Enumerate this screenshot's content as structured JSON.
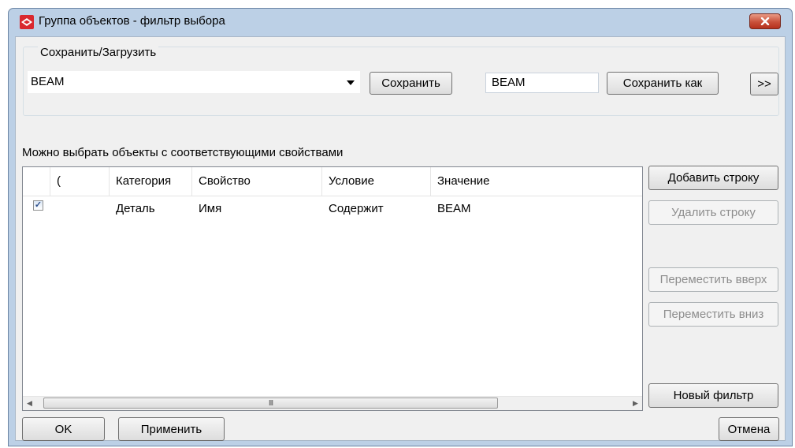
{
  "window": {
    "title": "Группа объектов - фильтр выбора",
    "close_label": "x",
    "accent": "#bcd0e6"
  },
  "save_load": {
    "label": "Сохранить/Загрузить",
    "combo_value": "BEAM",
    "save_label": "Сохранить",
    "name_value": "BEAM",
    "save_as_label": "Сохранить как",
    "more_label": ">>"
  },
  "hint": "Можно выбрать объекты с соответствующими свойствами",
  "table": {
    "columns": [
      "(",
      "Категория",
      "Свойство",
      "Условие",
      "Значение"
    ],
    "rows": [
      {
        "checked": true,
        "paren": "",
        "category": "Деталь",
        "property": "Имя",
        "condition": "Содержит",
        "value": "BEAM"
      }
    ],
    "scroll_thumb": "III"
  },
  "side_buttons": {
    "add_row": "Добавить строку",
    "delete_row": "Удалить строку",
    "move_up": "Переместить вверх",
    "move_down": "Переместить вниз",
    "new_filter": "Новый фильтр"
  },
  "footer": {
    "ok": "OK",
    "apply": "Применить",
    "cancel": "Отмена"
  }
}
